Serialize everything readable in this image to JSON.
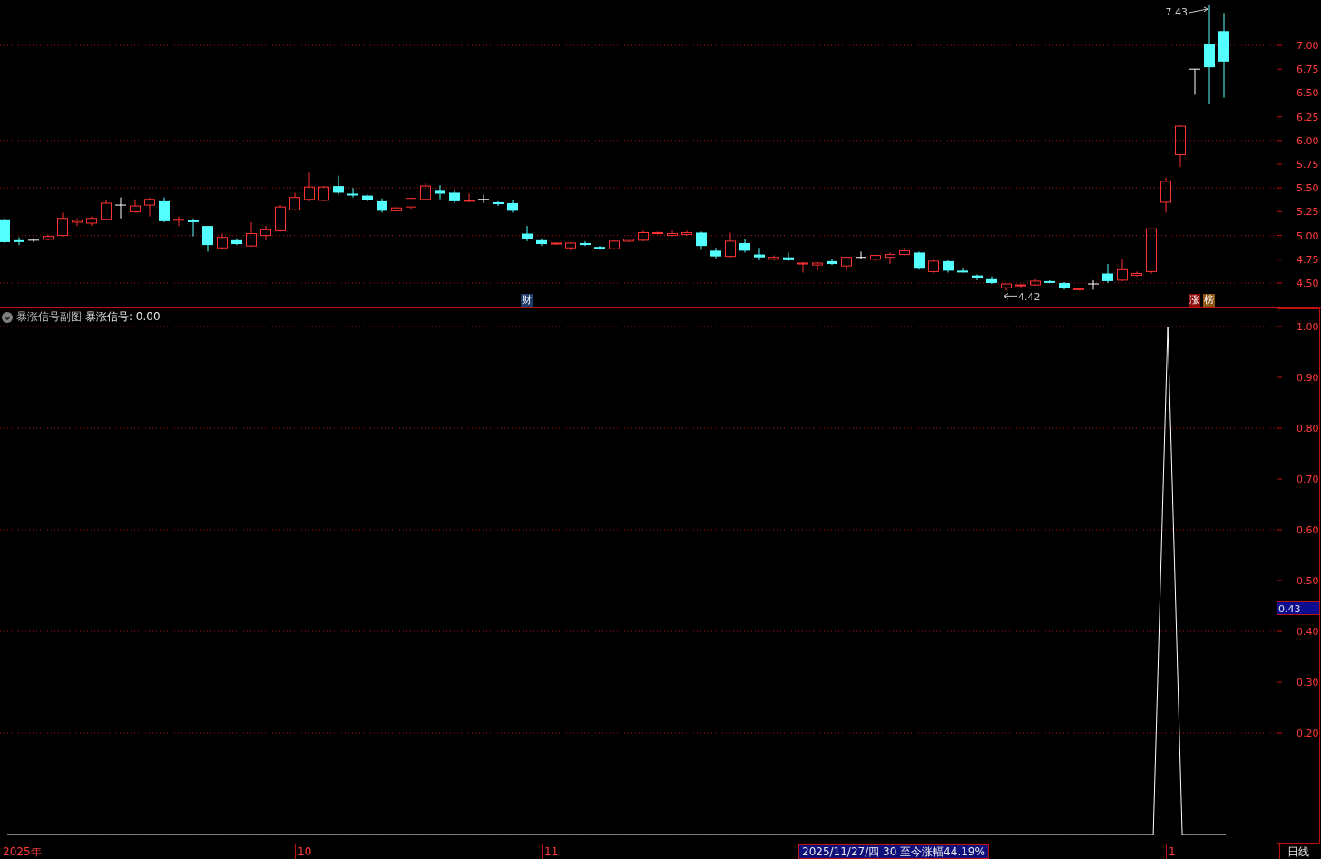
{
  "price_panel": {
    "axis_labels": [
      "7.00",
      "6.75",
      "6.50",
      "6.25",
      "6.00",
      "5.75",
      "5.50",
      "5.25",
      "5.00",
      "4.75",
      "4.50"
    ],
    "high_label": "7.43",
    "low_label": "4.42",
    "event_badges": [
      {
        "text": "财",
        "color": "#1c3c6c"
      },
      {
        "text": "涨",
        "color": "#8c0c0c"
      },
      {
        "text": "榜",
        "color": "#8c5414"
      }
    ]
  },
  "indicator_panel": {
    "title": "暴涨信号副图",
    "value_label": "暴涨信号: 0.00",
    "cursor_value": "0.43",
    "chart_data": {
      "type": "line",
      "grid": true,
      "ylim": [
        0,
        1
      ],
      "series": [
        {
          "color": "#ffffff",
          "values": [
            0,
            0,
            0,
            0,
            0,
            0,
            0,
            0,
            0,
            0,
            0,
            0,
            0,
            0,
            0,
            0,
            0,
            0,
            0,
            0,
            0,
            0,
            0,
            0,
            0,
            0,
            0,
            0,
            0,
            0,
            0,
            0,
            0,
            0,
            0,
            0,
            0,
            0,
            0,
            0,
            0,
            0,
            0,
            0,
            0,
            0,
            0,
            0,
            0,
            0,
            0,
            0,
            0,
            0,
            0,
            0,
            0,
            0,
            0,
            0,
            0,
            0,
            0,
            0,
            0,
            0,
            0,
            0,
            0,
            0,
            0,
            0,
            0,
            0,
            0,
            0,
            0,
            0,
            0,
            0,
            1,
            0,
            0,
            0,
            0,
            null,
            null,
            null
          ]
        }
      ],
      "yticks": [
        {
          "value": 0.2,
          "label": "0.20"
        },
        {
          "value": 0.3,
          "label": "0.30"
        },
        {
          "value": 0.4,
          "label": "0.40"
        },
        {
          "value": 0.5,
          "label": "0.50"
        },
        {
          "value": 0.6,
          "label": "0.60"
        },
        {
          "value": 0.7,
          "label": "0.70"
        },
        {
          "value": 0.8,
          "label": "0.80"
        },
        {
          "value": 0.9,
          "label": "0.90"
        },
        {
          "value": 1,
          "label": "1.00"
        }
      ]
    }
  },
  "status_bar": {
    "time_labels": [
      "2025年",
      "10",
      "11",
      "1"
    ],
    "info": "2025/11/27/四 30 至今涨幅44.19%",
    "period": "日线"
  }
}
